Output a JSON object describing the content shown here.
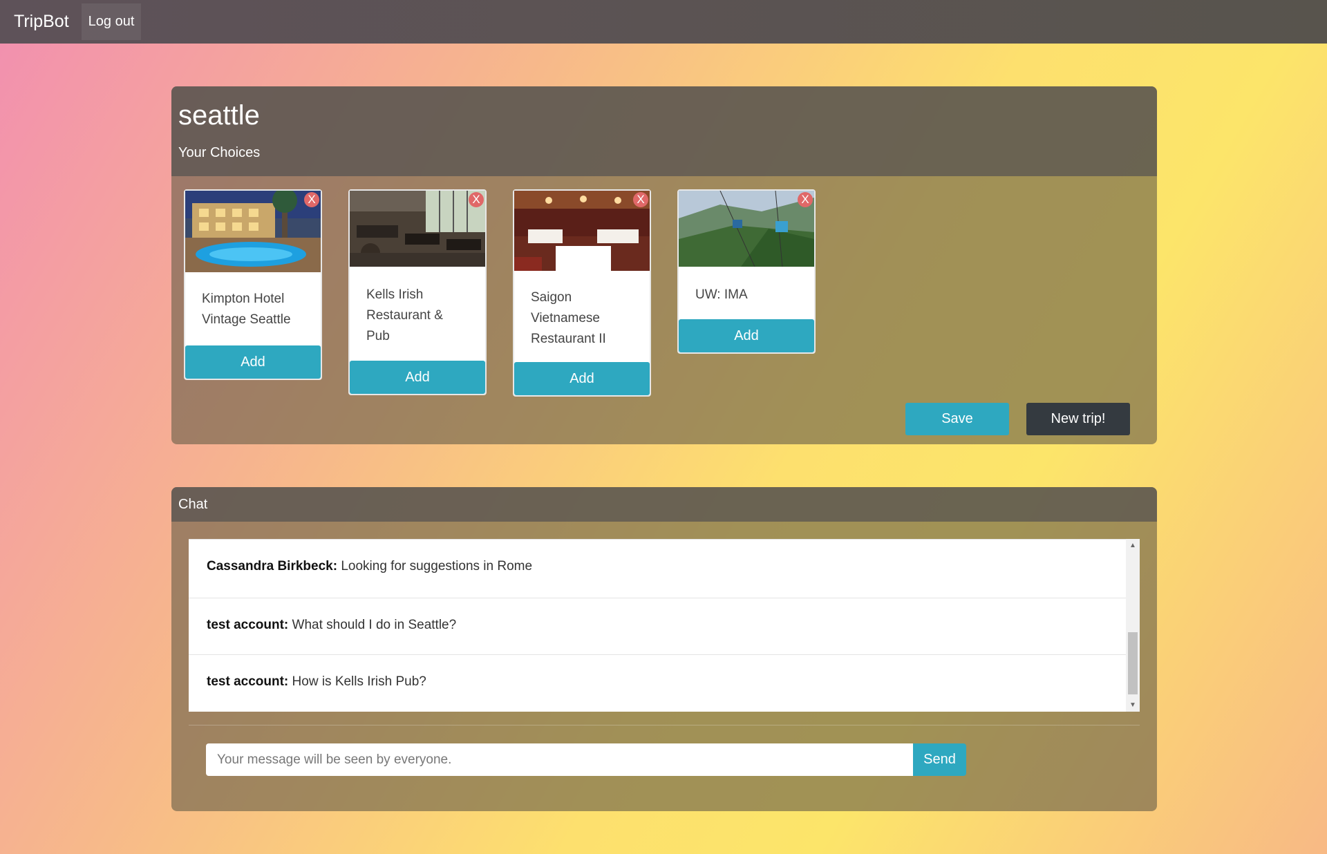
{
  "navbar": {
    "brand": "TripBot",
    "logout_label": "Log out"
  },
  "trip": {
    "title": "seattle",
    "choices_label": "Your Choices",
    "remove_label": "X",
    "add_label": "Add",
    "save_label": "Save",
    "new_trip_label": "New trip!",
    "cards": [
      {
        "name": "Kimpton Hotel Vintage Seattle",
        "image": "hotel-pool-photo"
      },
      {
        "name": "Kells Irish Restaurant & Pub",
        "image": "restaurant-interior-photo"
      },
      {
        "name": "Saigon Vietnamese Restaurant II",
        "image": "dining-room-photo"
      },
      {
        "name": "UW: IMA",
        "image": "cable-car-photo"
      }
    ]
  },
  "chat": {
    "title": "Chat",
    "messages": [
      {
        "author": "Cassandra Birkbeck:",
        "text": "Looking for suggestions in Rome"
      },
      {
        "author": "test account:",
        "text": "What should I do in Seattle?"
      },
      {
        "author": "test account:",
        "text": "How is Kells Irish Pub?"
      }
    ],
    "input_placeholder": "Your message will be seen by everyone.",
    "send_label": "Send"
  },
  "colors": {
    "accent": "#2ea8c0",
    "dark_button": "#343a40",
    "remove": "#e06868"
  }
}
